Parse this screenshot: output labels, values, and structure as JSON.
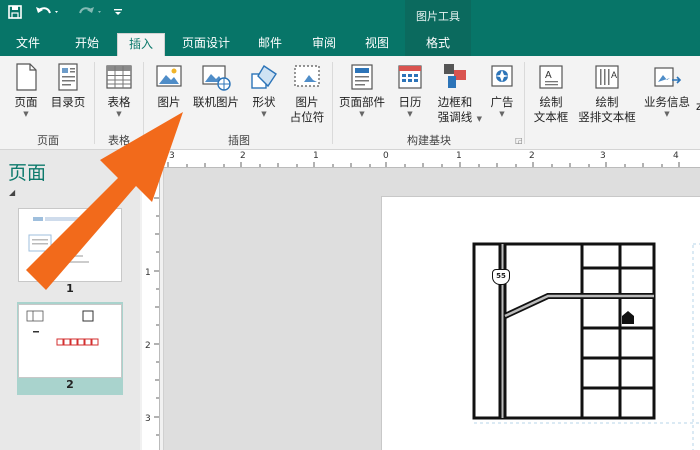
{
  "title_bar": {
    "save_icon": "save-icon",
    "undo_icon": "undo-icon",
    "redo_icon": "redo-icon",
    "customize_icon": "customize-qat-icon",
    "context_title": "图片工具"
  },
  "tabs": [
    {
      "label": "文件"
    },
    {
      "label": "开始"
    },
    {
      "label": "插入",
      "active": true
    },
    {
      "label": "页面设计"
    },
    {
      "label": "邮件"
    },
    {
      "label": "审阅"
    },
    {
      "label": "视图"
    },
    {
      "label": "格式"
    }
  ],
  "ribbon": {
    "groups": {
      "pages": "页面",
      "tables": "表格",
      "illustrations": "插图",
      "building_blocks": "构建基块"
    },
    "buttons": {
      "page": "页面",
      "catalog_page": "目录页",
      "table": "表格",
      "picture": "图片",
      "online_picture": "联机图片",
      "shapes": "形状",
      "picture_placeholder_1": "图片",
      "picture_placeholder_2": "占位符",
      "page_parts": "页面部件",
      "calendar": "日历",
      "borders_1": "边框和",
      "borders_2": "强调线",
      "ads": "广告",
      "textbox_1": "绘制",
      "textbox_2": "文本框",
      "vtextbox_1": "绘制",
      "vtextbox_2": "竖排文本框",
      "business_info": "业务信息",
      "business_info_cut": "z"
    }
  },
  "pages_pane": {
    "title": "页面",
    "thumbnails": [
      {
        "number": "1"
      },
      {
        "number": "2",
        "selected": true
      }
    ]
  },
  "rulers": {
    "horizontal": [
      "3",
      "2",
      "1",
      "0",
      "1",
      "2",
      "3",
      "4"
    ],
    "vertical": [
      "1",
      "2",
      "3"
    ]
  },
  "document": {
    "route_sign": "55"
  },
  "colors": {
    "brand": "#077568",
    "accent_arrow": "#f26a1b"
  }
}
